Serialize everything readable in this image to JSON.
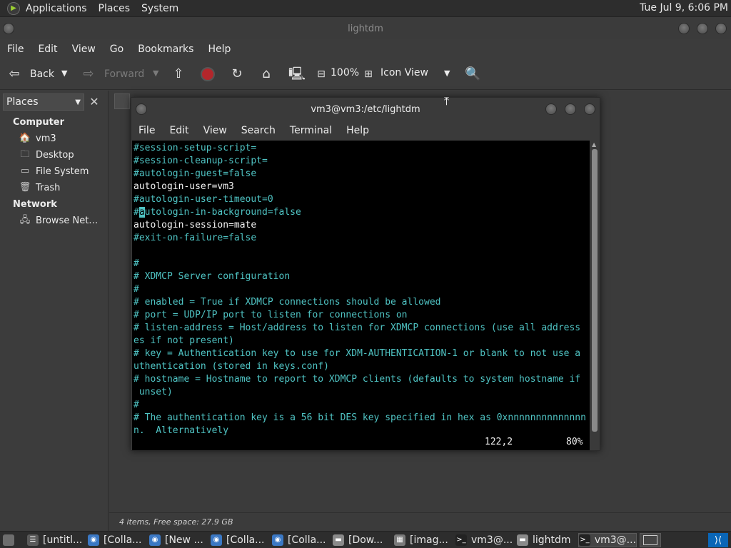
{
  "top_panel": {
    "menus": [
      "Applications",
      "Places",
      "System"
    ],
    "clock": "Tue Jul  9,  6:06 PM"
  },
  "file_manager": {
    "title": "lightdm",
    "menu": [
      "File",
      "Edit",
      "View",
      "Go",
      "Bookmarks",
      "Help"
    ],
    "toolbar": {
      "back": "Back",
      "forward": "Forward",
      "zoom": "100%",
      "view_mode": "Icon View"
    },
    "sidebar": {
      "header": "Places",
      "sections": [
        {
          "title": "Computer",
          "items": [
            {
              "label": "vm3",
              "icon": "home-folder-icon"
            },
            {
              "label": "Desktop",
              "icon": "desktop-folder-icon"
            },
            {
              "label": "File System",
              "icon": "drive-icon"
            },
            {
              "label": "Trash",
              "icon": "trash-icon"
            }
          ]
        },
        {
          "title": "Network",
          "items": [
            {
              "label": "Browse Net…",
              "icon": "network-icon"
            }
          ]
        }
      ]
    },
    "status": "4 items, Free space: 27.9 GB"
  },
  "terminal": {
    "title": "vm3@vm3:/etc/lightdm",
    "menu": [
      "File",
      "Edit",
      "View",
      "Search",
      "Terminal",
      "Help"
    ],
    "lines": [
      {
        "t": "#session-setup-script=",
        "c": "c"
      },
      {
        "t": "#session-cleanup-script=",
        "c": "c"
      },
      {
        "t": "#autologin-guest=false",
        "c": "c"
      },
      {
        "t": "autologin-user=vm3",
        "c": "w"
      },
      {
        "t": "#autologin-user-timeout=0",
        "c": "c"
      },
      {
        "t": "#autologin-in-background=false",
        "c": "c",
        "cursor": 1
      },
      {
        "t": "autologin-session=mate",
        "c": "w"
      },
      {
        "t": "#exit-on-failure=false",
        "c": "c"
      },
      {
        "t": "",
        "c": "c"
      },
      {
        "t": "#",
        "c": "c"
      },
      {
        "t": "# XDMCP Server configuration",
        "c": "c"
      },
      {
        "t": "#",
        "c": "c"
      },
      {
        "t": "# enabled = True if XDMCP connections should be allowed",
        "c": "c"
      },
      {
        "t": "# port = UDP/IP port to listen for connections on",
        "c": "c"
      },
      {
        "t": "# listen-address = Host/address to listen for XDMCP connections (use all address",
        "c": "c"
      },
      {
        "t": "es if not present)",
        "c": "c"
      },
      {
        "t": "# key = Authentication key to use for XDM-AUTHENTICATION-1 or blank to not use a",
        "c": "c"
      },
      {
        "t": "uthentication (stored in keys.conf)",
        "c": "c"
      },
      {
        "t": "# hostname = Hostname to report to XDMCP clients (defaults to system hostname if",
        "c": "c"
      },
      {
        "t": " unset)",
        "c": "c"
      },
      {
        "t": "#",
        "c": "c"
      },
      {
        "t": "# The authentication key is a 56 bit DES key specified in hex as 0xnnnnnnnnnnnnnn",
        "c": "c"
      },
      {
        "t": "n.  Alternatively",
        "c": "c"
      }
    ],
    "position": "122,2",
    "percent": "80%"
  },
  "taskbar": {
    "tasks": [
      {
        "label": "[untitl...",
        "icon": "document-icon"
      },
      {
        "label": "[Colla...",
        "icon": "chrome-icon"
      },
      {
        "label": "[New ...",
        "icon": "chrome-icon"
      },
      {
        "label": "[Colla...",
        "icon": "chrome-icon"
      },
      {
        "label": "[Colla...",
        "icon": "chrome-icon"
      },
      {
        "label": "[Dow...",
        "icon": "folder-icon"
      },
      {
        "label": "[imag...",
        "icon": "image-viewer-icon"
      },
      {
        "label": "vm3@...",
        "icon": "terminal-icon"
      },
      {
        "label": "lightdm",
        "icon": "folder-icon"
      },
      {
        "label": "vm3@...",
        "icon": "terminal-icon",
        "active": true
      }
    ]
  },
  "colors": {
    "panel_bg": "#2d2d2d",
    "window_bg": "#3c3c3c",
    "terminal_bg": "#000000",
    "terminal_comment": "#4fc3c3",
    "terminal_text": "#f2f2f2",
    "vscode_blue": "#0a66b7"
  }
}
